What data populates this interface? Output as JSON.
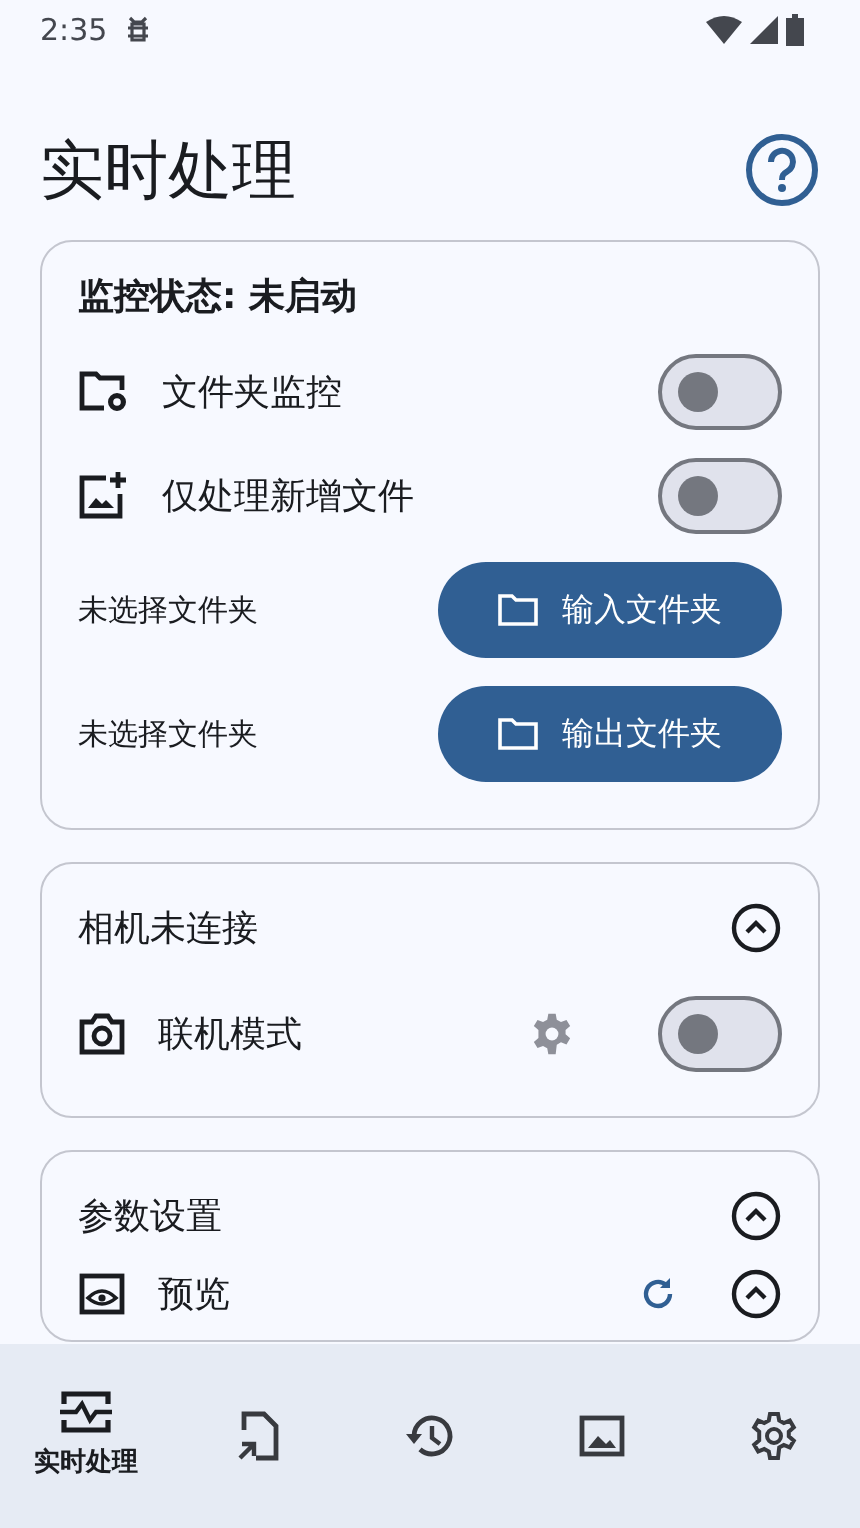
{
  "status_bar": {
    "time": "2:35"
  },
  "title": "实时处理",
  "monitor_card": {
    "status": "监控状态: 未启动",
    "switches": [
      {
        "label": "文件夹监控",
        "on": false
      },
      {
        "label": "仅处理新增文件",
        "on": false
      }
    ],
    "folders": [
      {
        "path": "未选择文件夹",
        "button": "输入文件夹"
      },
      {
        "path": "未选择文件夹",
        "button": "输出文件夹"
      }
    ]
  },
  "camera_card": {
    "title": "相机未连接",
    "expanded": true,
    "mode": {
      "label": "联机模式",
      "on": false
    }
  },
  "params_card": {
    "title": "参数设置",
    "expanded": true,
    "rows": [
      {
        "label": "预览",
        "expanded": true
      }
    ]
  },
  "bottom_nav": [
    {
      "label": "实时处理",
      "selected": true
    },
    {
      "selected": false
    },
    {
      "selected": false
    },
    {
      "selected": false
    },
    {
      "selected": false
    }
  ]
}
